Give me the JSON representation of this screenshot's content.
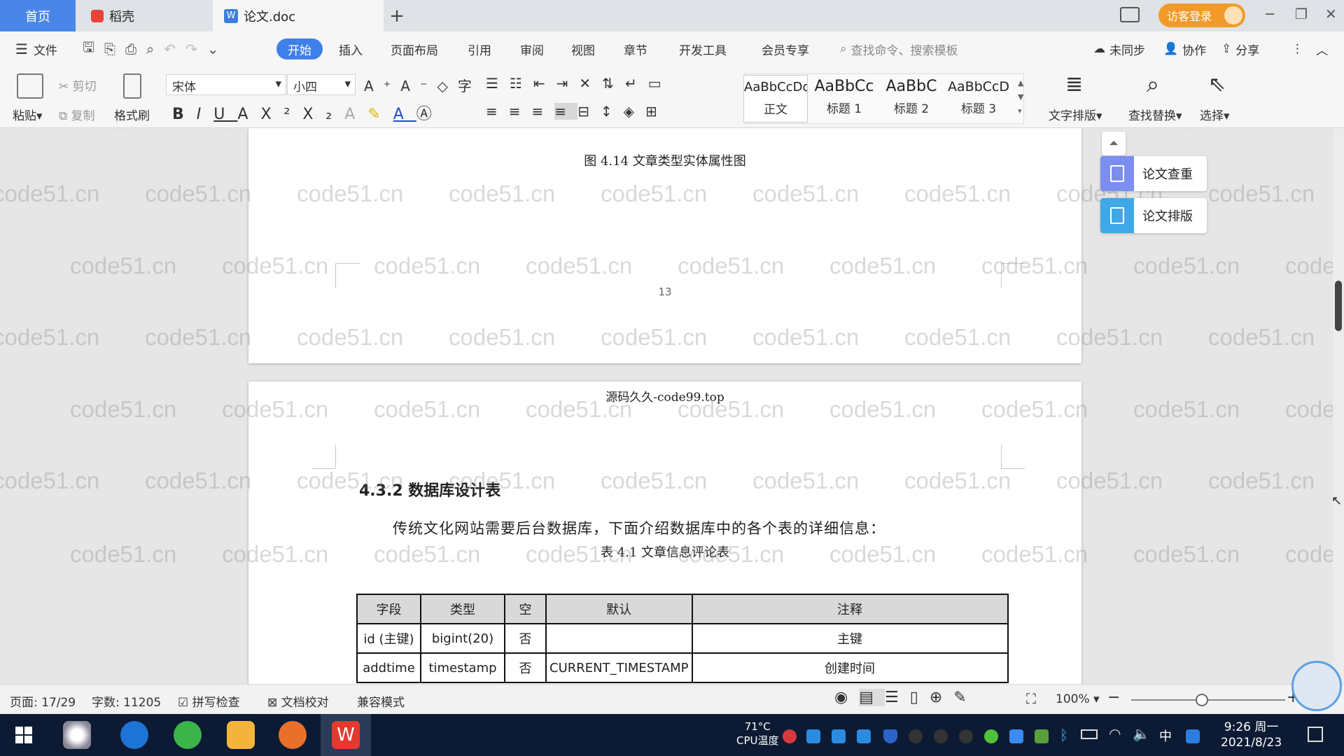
{
  "tabs": {
    "home": "首页",
    "daoke": "稻壳",
    "doc": "论文.doc",
    "add": "+",
    "login": "访客登录"
  },
  "menu": {
    "file": "文件",
    "items": [
      "开始",
      "插入",
      "页面布局",
      "引用",
      "审阅",
      "视图",
      "章节",
      "开发工具",
      "会员专享"
    ],
    "search_placeholder": "查找命令、搜索模板",
    "sync": "未同步",
    "collab": "协作",
    "share": "分享"
  },
  "ribbon": {
    "paste": "粘贴",
    "cut": "剪切",
    "copy": "复制",
    "format_painter": "格式刷",
    "font_name": "宋体",
    "font_size": "小四",
    "styles": [
      {
        "preview": "AaBbCcDd",
        "name": "正文"
      },
      {
        "preview": "AaBbCc",
        "name": "标题 1"
      },
      {
        "preview": "AaBbC",
        "name": "标题 2"
      },
      {
        "preview": "AaBbCcD",
        "name": "标题 3"
      }
    ],
    "text_layout": "文字排版",
    "find_replace": "查找替换",
    "select": "选择"
  },
  "document": {
    "figure_caption": "图 4.14  文章类型实体属性图",
    "page_number": "13",
    "header_text": "源码久久-code99.top",
    "section_heading": "4.3.2 数据库设计表",
    "intro": "传统文化网站需要后台数据库，下面介绍数据库中的各个表的详细信息：",
    "table_caption": "表 4.1  文章信息评论表",
    "table": {
      "headers": [
        "字段",
        "类型",
        "空",
        "默认",
        "注释"
      ],
      "rows": [
        [
          "id (主键)",
          "bigint(20)",
          "否",
          "",
          "主键"
        ],
        [
          "addtime",
          "timestamp",
          "否",
          "CURRENT_TIMESTAMP",
          "创建时间"
        ]
      ]
    },
    "watermark": "code51.cn"
  },
  "side_panel": {
    "check": "论文查重",
    "layout": "论文排版"
  },
  "status": {
    "page": "页面: 17/29",
    "words": "字数: 11205",
    "spell": "拼写检查",
    "proof": "文档校对",
    "compat": "兼容模式",
    "zoom": "100%"
  },
  "taskbar": {
    "temp": "71°C",
    "cpu": "CPU温度",
    "time": "9:26 周一",
    "date": "2021/8/23",
    "ime": "中"
  },
  "colors": {
    "accent": "#3f7fe8",
    "login": "#f19a2a",
    "taskbar": "#0c1a33"
  }
}
